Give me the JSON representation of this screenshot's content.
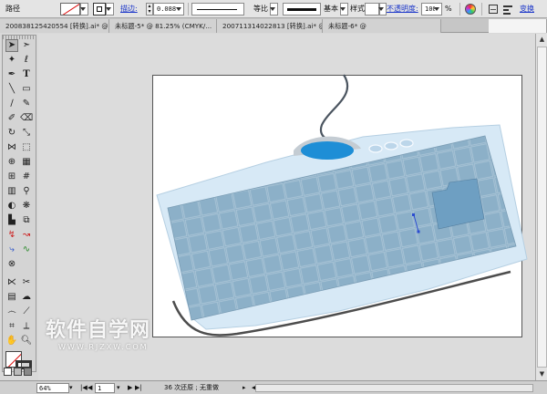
{
  "control_bar": {
    "panel_title": "路径",
    "stroke_label": "描边:",
    "stroke_weight": "0.088",
    "profile_label": "等比",
    "brush_label": "基本",
    "style_label": "样式:",
    "opacity_label": "不透明度:",
    "opacity_value": "100",
    "opacity_unit": "%",
    "transform_label": "变换"
  },
  "tabs": [
    {
      "label": "200838125420554 [转换].ai* @ 74% (CMYK/..."
    },
    {
      "label": "未标题-5* @ 81.25% (CMYK/..."
    },
    {
      "label": "200711314022813 [转换].ai* @ 86% (CMYK/..."
    },
    {
      "label": "未标题-6* @"
    }
  ],
  "status_bar": {
    "zoom": "64%",
    "page": "1",
    "info": "36 次还原 ; 无重做"
  },
  "watermark": {
    "title": "软件自学网",
    "url": "WWW.RJZXW.COM"
  },
  "colors": {
    "keyboard_body": "#d7e9f6",
    "keyboard_keys": "#8cb0c8",
    "trackpad": "#6e9fc2",
    "logo_blue": "#1e8ed6",
    "accent_link": "#1a35c9"
  }
}
